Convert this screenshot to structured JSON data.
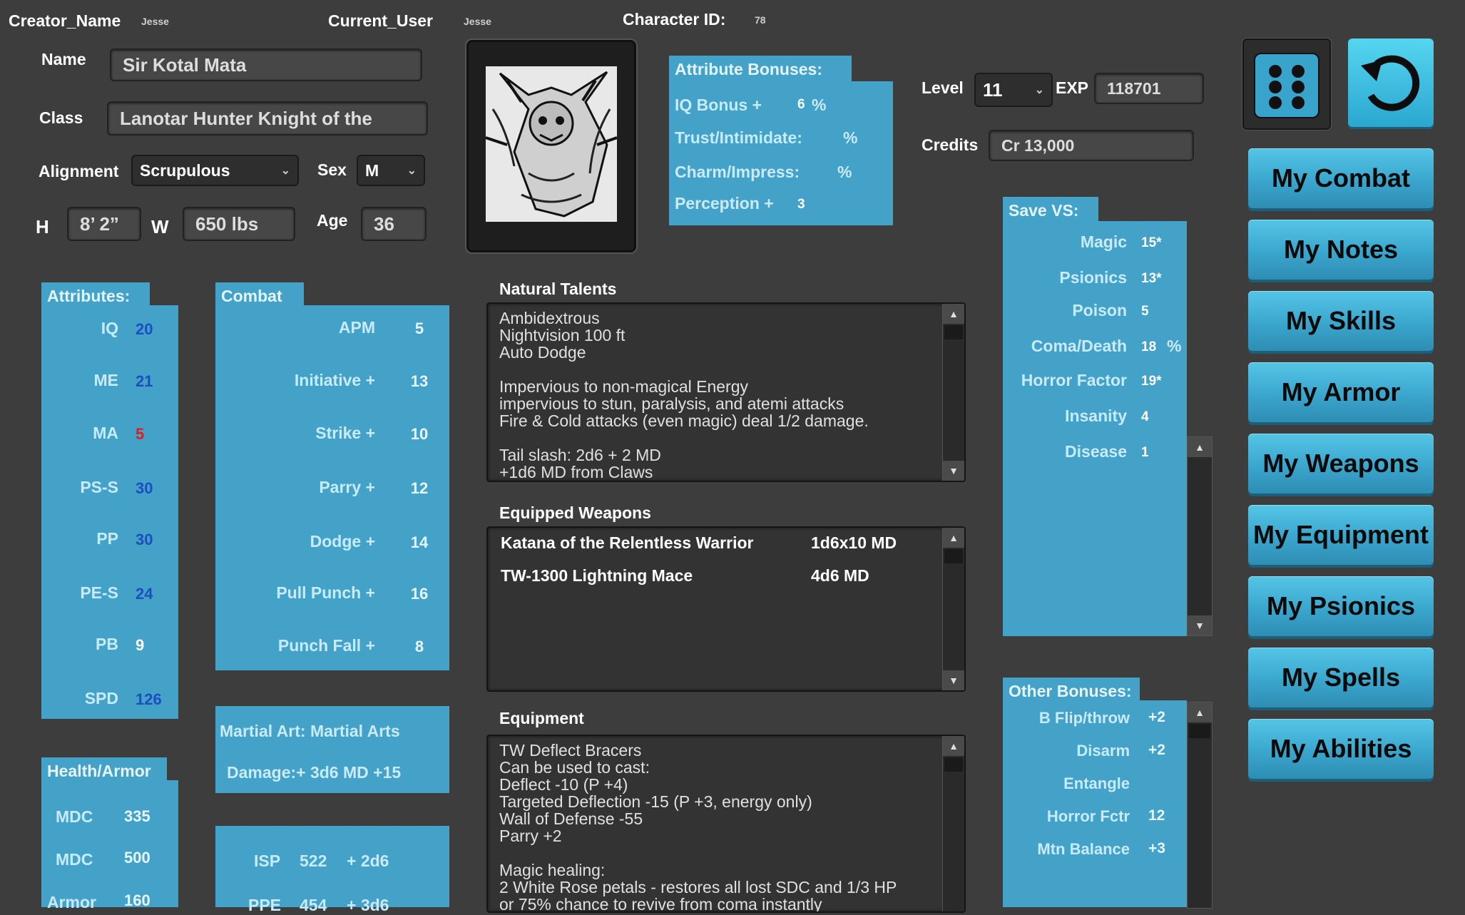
{
  "header": {
    "creator_label": "Creator_Name",
    "creator_value": "Jesse",
    "current_user_label": "Current_User",
    "current_user_value": "Jesse",
    "character_id_label": "Character ID:",
    "character_id_value": "78"
  },
  "identity": {
    "name_label": "Name",
    "name_value": "Sir Kotal Mata",
    "class_label": "Class",
    "class_value": "Lanotar Hunter Knight of the",
    "alignment_label": "Alignment",
    "alignment_value": "Scrupulous",
    "sex_label": "Sex",
    "sex_value": "M",
    "h_label": "H",
    "h_value": "8’ 2”",
    "w_label": "W",
    "w_value": "650 lbs",
    "age_label": "Age",
    "age_value": "36"
  },
  "attribute_bonuses": {
    "title": "Attribute Bonuses:",
    "rows": [
      {
        "label": "IQ Bonus +",
        "value": "6",
        "suffix": "%"
      },
      {
        "label": "Trust/Intimidate:",
        "value": "",
        "suffix": "%"
      },
      {
        "label": "Charm/Impress:",
        "value": "",
        "suffix": "%"
      },
      {
        "label": "Perception +",
        "value": "3",
        "suffix": ""
      }
    ]
  },
  "level": {
    "level_label": "Level",
    "level_value": "11",
    "exp_label": "EXP",
    "exp_value": "118701",
    "credits_label": "Credits",
    "credits_value": "Cr 13,000"
  },
  "attributes": {
    "title": "Attributes:",
    "rows": [
      {
        "label": "IQ",
        "value": "20",
        "color": "#1b4fc0"
      },
      {
        "label": "ME",
        "value": "21",
        "color": "#1b4fc0"
      },
      {
        "label": "MA",
        "value": "5",
        "color": "#e21b1b"
      },
      {
        "label": "PS-S",
        "value": "30",
        "color": "#1b4fc0"
      },
      {
        "label": "PP",
        "value": "30",
        "color": "#1b4fc0"
      },
      {
        "label": "PE-S",
        "value": "24",
        "color": "#1b4fc0"
      },
      {
        "label": "PB",
        "value": "9",
        "color": "#ffffff"
      },
      {
        "label": "SPD",
        "value": "126",
        "color": "#1b4fc0"
      }
    ]
  },
  "combat": {
    "title": "Combat",
    "rows": [
      {
        "label": "APM",
        "value": "5"
      },
      {
        "label": "Initiative +",
        "value": "13"
      },
      {
        "label": "Strike +",
        "value": "10"
      },
      {
        "label": "Parry +",
        "value": "12"
      },
      {
        "label": "Dodge +",
        "value": "14"
      },
      {
        "label": "Pull Punch +",
        "value": "16"
      },
      {
        "label": "Punch Fall +",
        "value": "8"
      }
    ]
  },
  "martial": {
    "art_line": "Martial Art: Martial Arts",
    "damage_line": "Damage:+ 3d6 MD +15"
  },
  "health": {
    "title": "Health/Armor",
    "rows": [
      {
        "label": "MDC",
        "value": "335"
      },
      {
        "label": "MDC",
        "value": "500"
      },
      {
        "label": "Armor",
        "value": "160"
      }
    ]
  },
  "energy": {
    "rows": [
      {
        "label": "ISP",
        "value": "522",
        "extra": "+ 2d6"
      },
      {
        "label": "PPE",
        "value": "454",
        "extra": "+ 3d6"
      }
    ]
  },
  "talents": {
    "title": "Natural Talents",
    "text": "Ambidextrous\nNightvision 100 ft\nAuto Dodge\n\nImpervious to non-magical Energy\nimpervious to stun, paralysis, and atemi attacks\nFire & Cold attacks (even magic) deal 1/2 damage.\n\nTail slash: 2d6 + 2 MD\n+1d6 MD from Claws"
  },
  "weapons": {
    "title": "Equipped Weapons",
    "rows": [
      {
        "name": "Katana of the Relentless Warrior",
        "damage": "1d6x10 MD"
      },
      {
        "name": "TW-1300 Lightning Mace",
        "damage": "4d6 MD"
      }
    ]
  },
  "equipment": {
    "title": "Equipment",
    "text": "TW Deflect Bracers\nCan be used to cast:\nDeflect -10 (P +4)\nTargeted Deflection -15 (P +3, energy only)\nWall of Defense -55\nParry +2\n\nMagic healing:\n2 White Rose petals - restores all lost SDC and 1/3 HP\nor 75% chance to revive from coma instantly"
  },
  "save_vs": {
    "title": "Save VS:",
    "rows": [
      {
        "label": "Magic",
        "value": "15*",
        "suffix": ""
      },
      {
        "label": "Psionics",
        "value": "13*",
        "suffix": ""
      },
      {
        "label": "Poison",
        "value": "5",
        "suffix": ""
      },
      {
        "label": "Coma/Death",
        "value": "18",
        "suffix": "%"
      },
      {
        "label": "Horror Factor",
        "value": "19*",
        "suffix": ""
      },
      {
        "label": "Insanity",
        "value": "4",
        "suffix": ""
      },
      {
        "label": "Disease",
        "value": "1",
        "suffix": ""
      }
    ]
  },
  "other_bonuses": {
    "title": "Other Bonuses:",
    "rows": [
      {
        "label": "B Flip/throw",
        "value": "+2"
      },
      {
        "label": "Disarm",
        "value": "+2"
      },
      {
        "label": "Entangle",
        "value": ""
      },
      {
        "label": "Horror Fctr",
        "value": "12"
      },
      {
        "label": "Mtn Balance",
        "value": "+3"
      }
    ]
  },
  "nav": [
    {
      "label": "My Combat"
    },
    {
      "label": "My Notes"
    },
    {
      "label": "My Skills"
    },
    {
      "label": "My Armor"
    },
    {
      "label": "My Weapons"
    },
    {
      "label": "My Equipment"
    },
    {
      "label": "My Psionics"
    },
    {
      "label": "My Spells"
    },
    {
      "label": "My Abilities"
    }
  ],
  "icons": {
    "dice": "dice-icon",
    "refresh": "refresh-icon"
  },
  "colors": {
    "panel": "#44a2c9",
    "nav_button": "#3aa6cd",
    "value_blue": "#1b4fc0",
    "value_red": "#e21b1b",
    "background": "#3d3d3d"
  }
}
